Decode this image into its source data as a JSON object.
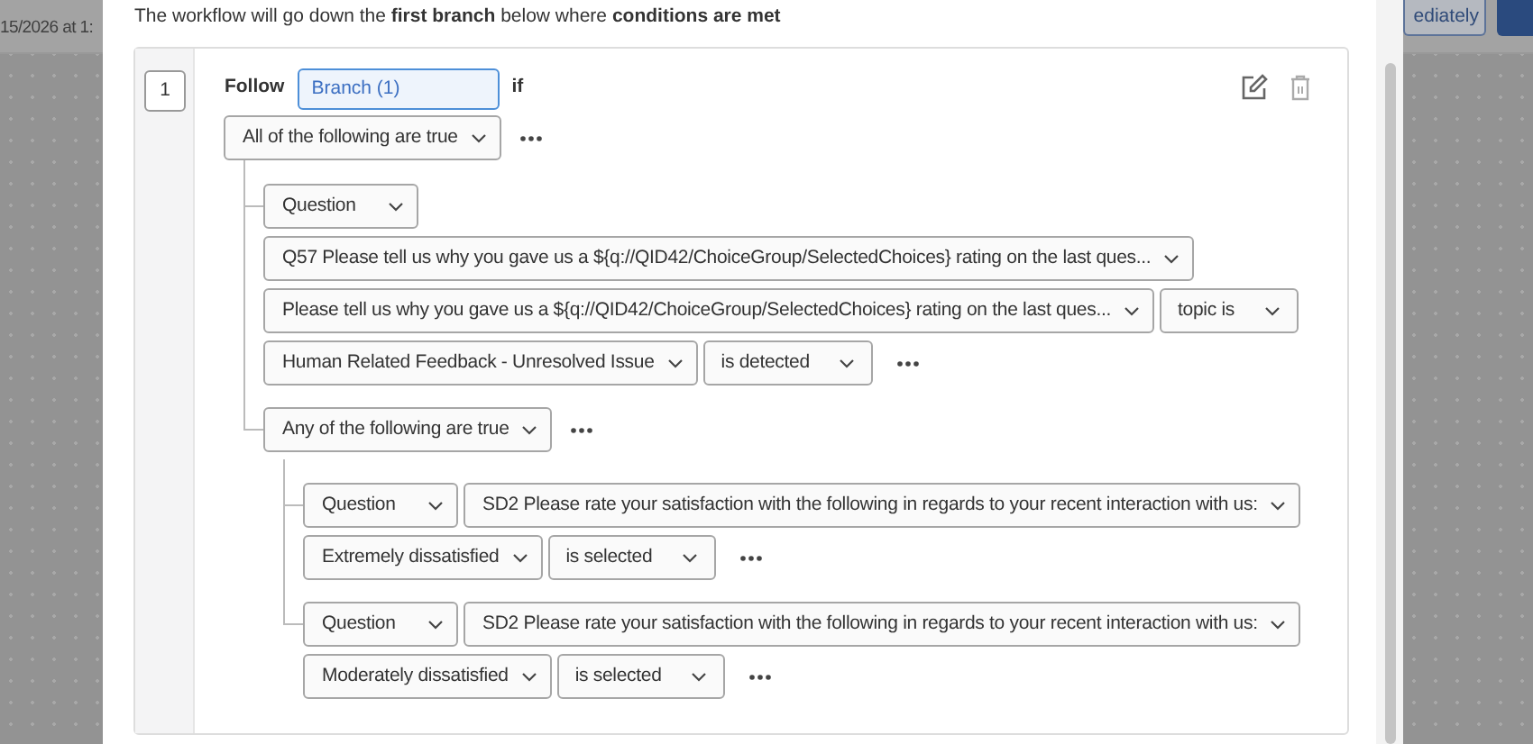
{
  "background": {
    "date_text": "15/2026 at 1:",
    "button_label": "ediately"
  },
  "intro": "The workflow will go down the **first branch** below where **conditions are met**",
  "branch": {
    "number": "1",
    "follow_label": "Follow",
    "name": "Branch (1)",
    "if_label": "if",
    "group": {
      "conjunction": "All of the following are true",
      "items": [
        {
          "kind": "condition",
          "rows": [
            {
              "fields": [
                {
                  "kind": "type",
                  "label": "Question"
                }
              ]
            },
            {
              "fields": [
                {
                  "kind": "value",
                  "label": "Q57 Please tell us why you gave us a ${q://QID42/ChoiceGroup/SelectedChoices} rating on the last ques..."
                }
              ]
            },
            {
              "fields": [
                {
                  "kind": "value",
                  "label": "Please tell us why you gave us a ${q://QID42/ChoiceGroup/SelectedChoices} rating on the last ques..."
                },
                {
                  "kind": "operator",
                  "label": "topic is"
                }
              ]
            },
            {
              "fields": [
                {
                  "kind": "value",
                  "label": "Human Related Feedback - Unresolved Issue"
                },
                {
                  "kind": "operator",
                  "label": "is detected"
                }
              ]
            }
          ]
        },
        {
          "kind": "group",
          "conjunction": "Any of the following are true",
          "items": [
            {
              "kind": "condition",
              "rows": [
                {
                  "fields": [
                    {
                      "kind": "type",
                      "label": "Question"
                    },
                    {
                      "kind": "value",
                      "label": "SD2 Please rate your satisfaction with the following in regards to your recent interaction with us:"
                    }
                  ]
                },
                {
                  "fields": [
                    {
                      "kind": "value",
                      "label": "Extremely dissatisfied"
                    },
                    {
                      "kind": "operator",
                      "label": "is selected"
                    }
                  ]
                }
              ]
            },
            {
              "kind": "condition",
              "rows": [
                {
                  "fields": [
                    {
                      "kind": "type",
                      "label": "Question"
                    },
                    {
                      "kind": "value",
                      "label": "SD2 Please rate your satisfaction with the following in regards to your recent interaction with us:"
                    }
                  ]
                },
                {
                  "fields": [
                    {
                      "kind": "value",
                      "label": "Moderately dissatisfied"
                    },
                    {
                      "kind": "operator",
                      "label": "is selected"
                    }
                  ]
                }
              ]
            }
          ]
        }
      ]
    }
  }
}
